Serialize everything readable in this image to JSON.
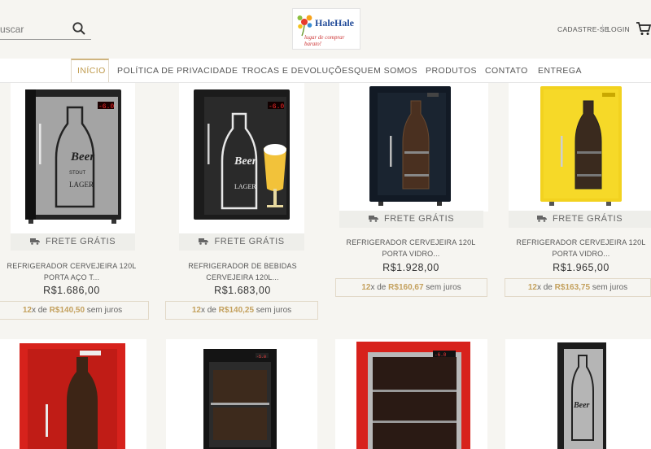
{
  "header": {
    "search_placeholder": "uscar",
    "logo_title": "HaleHale",
    "logo_tagline": "lugar de comprar barato!",
    "signup": "CADASTRE-SE",
    "login": "LOGIN"
  },
  "nav": {
    "items": [
      "INÍCIO",
      "POLÍTICA DE PRIVACIDADE",
      "TROCAS E DEVOLUÇÕES",
      "QUEM SOMOS",
      "PRODUTOS",
      "CONTATO",
      "ENTREGA"
    ]
  },
  "products": [
    {
      "shipping": "FRETE GRÁTIS",
      "name_line1": "REFRIGERADOR CERVEJEIRA 120L",
      "name_line2": "PORTA AÇO T...",
      "price": "R$1.686,00",
      "inst_count": "12",
      "inst_x": "x de ",
      "inst_value": "R$140,50",
      "inst_suffix": " sem juros",
      "display": "-6.0"
    },
    {
      "shipping": "FRETE GRÁTIS",
      "name_line1": "REFRIGERADOR DE BEBIDAS",
      "name_line2": "CERVEJEIRA 120L...",
      "price": "R$1.683,00",
      "inst_count": "12",
      "inst_x": "x de ",
      "inst_value": "R$140,25",
      "inst_suffix": " sem juros",
      "display": "-6.0"
    },
    {
      "shipping": "FRETE GRÁTIS",
      "name_line1": "REFRIGERADOR CERVEJEIRA 120L",
      "name_line2": "PORTA VIDRO...",
      "price": "R$1.928,00",
      "inst_count": "12",
      "inst_x": "x de ",
      "inst_value": "R$160,67",
      "inst_suffix": " sem juros"
    },
    {
      "shipping": "FRETE GRÁTIS",
      "name_line1": "REFRIGERADOR CERVEJEIRA 120L",
      "name_line2": "PORTA VIDRO...",
      "price": "R$1.965,00",
      "inst_count": "12",
      "inst_x": "x de ",
      "inst_value": "R$163,75",
      "inst_suffix": " sem juros"
    }
  ],
  "row2": {
    "displays": [
      "-5.0",
      "-6.0"
    ]
  },
  "colors": {
    "accent": "#c4a15e",
    "nav_active": "#bf9a4c",
    "fridge_black": "#1b1b1b",
    "fridge_red": "#d7221c",
    "fridge_yellow": "#f2d21f"
  }
}
